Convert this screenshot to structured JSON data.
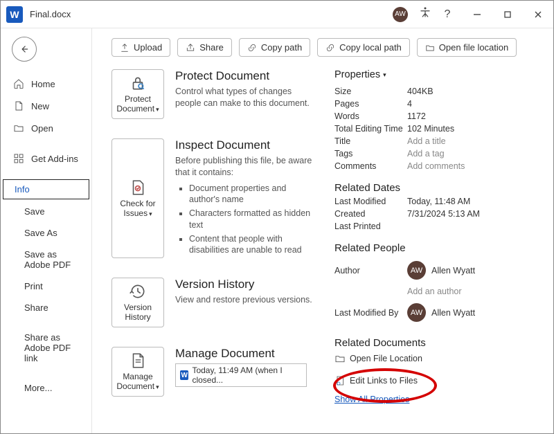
{
  "titlebar": {
    "filename": "Final.docx",
    "avatar_initials": "AW"
  },
  "sidebar": {
    "home": "Home",
    "new": "New",
    "open": "Open",
    "addins": "Get Add-ins",
    "info": "Info",
    "save": "Save",
    "save_as": "Save As",
    "save_adobe": "Save as Adobe PDF",
    "print": "Print",
    "share": "Share",
    "share_adobe": "Share as Adobe PDF link",
    "more": "More..."
  },
  "toolbar": {
    "upload": "Upload",
    "share": "Share",
    "copy_path": "Copy path",
    "copy_local": "Copy local path",
    "open_loc": "Open file location"
  },
  "sections": {
    "protect": {
      "button": "Protect Document",
      "title": "Protect Document",
      "text": "Control what types of changes people can make to this document."
    },
    "inspect": {
      "button": "Check for Issues",
      "title": "Inspect Document",
      "lead": "Before publishing this file, be aware that it contains:",
      "items": [
        "Document properties and author's name",
        "Characters formatted as hidden text",
        "Content that people with disabilities are unable to read"
      ]
    },
    "history": {
      "button": "Version History",
      "title": "Version History",
      "text": "View and restore previous versions."
    },
    "manage": {
      "button": "Manage Document",
      "title": "Manage Document",
      "autosave": "Today, 11:49 AM (when I closed..."
    }
  },
  "properties": {
    "heading": "Properties",
    "size_k": "Size",
    "size_v": "404KB",
    "pages_k": "Pages",
    "pages_v": "4",
    "words_k": "Words",
    "words_v": "1172",
    "edit_k": "Total Editing Time",
    "edit_v": "102 Minutes",
    "title_k": "Title",
    "title_v": "Add a title",
    "tags_k": "Tags",
    "tags_v": "Add a tag",
    "comments_k": "Comments",
    "comments_v": "Add comments"
  },
  "dates": {
    "heading": "Related Dates",
    "modified_k": "Last Modified",
    "modified_v": "Today, 11:48 AM",
    "created_k": "Created",
    "created_v": "7/31/2024 5:13 AM",
    "printed_k": "Last Printed",
    "printed_v": ""
  },
  "people": {
    "heading": "Related People",
    "author_k": "Author",
    "author_name": "Allen Wyatt",
    "author_initials": "AW",
    "add_author": "Add an author",
    "modifiedby_k": "Last Modified By",
    "modifiedby_name": "Allen Wyatt",
    "modifiedby_initials": "AW"
  },
  "related_docs": {
    "heading": "Related Documents",
    "open_loc": "Open File Location",
    "edit_links": "Edit Links to Files",
    "show_all": "Show All Properties"
  }
}
